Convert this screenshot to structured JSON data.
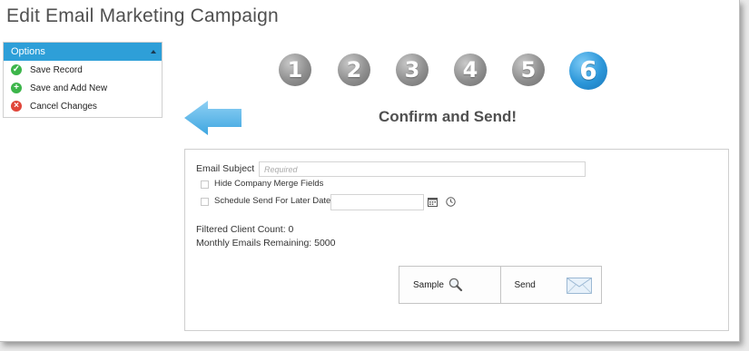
{
  "page": {
    "title": "Edit Email Marketing Campaign"
  },
  "options": {
    "header": "Options",
    "items": [
      {
        "label": "Save Record",
        "icon": "check-icon",
        "color": "#3cb54a"
      },
      {
        "label": "Save and Add New",
        "icon": "plus-icon",
        "color": "#3cb54a"
      },
      {
        "label": "Cancel Changes",
        "icon": "close-icon",
        "color": "#e0463a"
      }
    ]
  },
  "wizard": {
    "steps": [
      "1",
      "2",
      "3",
      "4",
      "5",
      "6"
    ],
    "active_step": 6,
    "heading": "Confirm and Send!"
  },
  "form": {
    "email_subject_label": "Email Subject",
    "email_subject_placeholder": "Required",
    "hide_merge_label": "Hide Company Merge Fields",
    "schedule_label": "Schedule Send For Later Date",
    "client_count": "Filtered Client Count: 0",
    "emails_remaining": "Monthly Emails Remaining: 5000"
  },
  "actions": {
    "sample_label": "Sample",
    "send_label": "Send"
  },
  "colors": {
    "accent": "#2e9fd8",
    "active_step": "#2b96d9",
    "inactive_step": "#8f8f8f"
  }
}
